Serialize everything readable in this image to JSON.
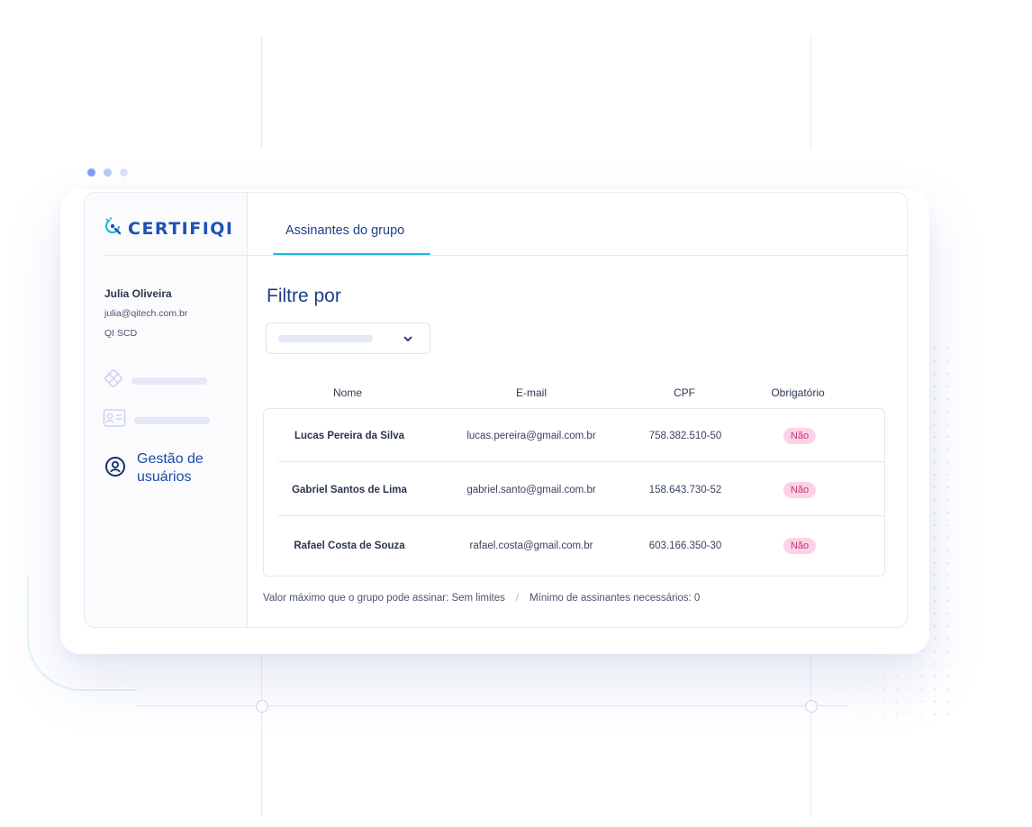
{
  "colors": {
    "brand": "#1d52b8",
    "accent": "#1fb9d9",
    "badge_bg": "#fcd3e6",
    "badge_text": "#c0347a",
    "window_dots": [
      "#7e9ef0",
      "#b9c8f4",
      "#d8e1f8"
    ]
  },
  "logo": {
    "text": "CERTIFIQI",
    "icon": "q-logo-icon"
  },
  "user": {
    "name": "Julia Oliveira",
    "email": "julia@qitech.com.br",
    "org": "QI SCD"
  },
  "sidebar": {
    "items": [
      {
        "icon": "diamond-grid-icon",
        "label": ""
      },
      {
        "icon": "id-card-icon",
        "label": ""
      },
      {
        "icon": "user-circle-icon",
        "label": "Gestão de usuários",
        "active": true
      }
    ]
  },
  "tabs": [
    {
      "label": "Assinantes do grupo",
      "active": true
    }
  ],
  "filter": {
    "title": "Filtre por",
    "icon": "chevron-down-icon"
  },
  "table": {
    "headers": [
      "Nome",
      "E-mail",
      "CPF",
      "Obrigatório"
    ],
    "rows": [
      {
        "name": "Lucas Pereira da Silva",
        "email": "lucas.pereira@gmail.com.br",
        "cpf": "758.382.510-50",
        "required": "Não"
      },
      {
        "name": "Gabriel Santos de Lima",
        "email": "gabriel.santo@gmail.com.br",
        "cpf": "158.643.730-52",
        "required": "Não"
      },
      {
        "name": "Rafael Costa de Souza",
        "email": "rafael.costa@gmail.com.br",
        "cpf": "603.166.350-30",
        "required": "Não"
      }
    ]
  },
  "footer": {
    "max_value": "Valor máximo que o grupo pode assinar: Sem limites",
    "separator": "/",
    "min_signers": "Mínimo de assinantes necessários: 0"
  }
}
